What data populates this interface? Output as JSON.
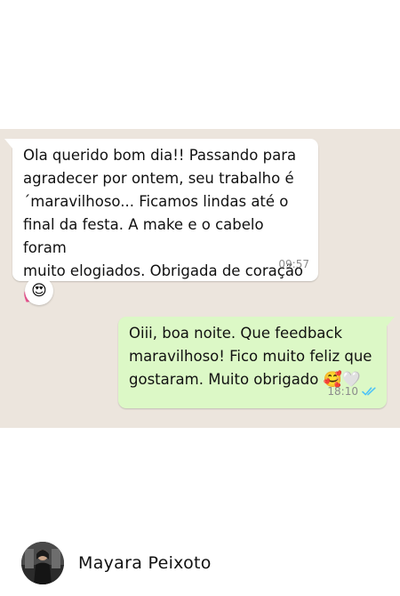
{
  "conversation": {
    "messages": [
      {
        "direction": "incoming",
        "text": "Ola querido bom dia!! Passando para\nagradecer por ontem, seu trabalho é\n´maravilhoso... Ficamos lindas até o\nfinal da festa. A make e o cabelo foram\nmuito elogiados. Obrigada de coração",
        "emoji": "💕",
        "time": "09:57",
        "reaction": "😍"
      },
      {
        "direction": "outgoing",
        "text": "Oiii, boa noite. Que feedback\nmaravilhoso! Fico muito feliz que\ngostaram. Muito obrigado ",
        "emoji": "🥰🤍",
        "time": "18:10",
        "status_icon": "double-check-read-icon",
        "status_color": "#4fc3f7"
      }
    ]
  },
  "author": {
    "name": "Mayara Peixoto"
  },
  "colors": {
    "chat_background": "#ece5dd",
    "incoming_bubble": "#ffffff",
    "outgoing_bubble": "#dcf8c6"
  }
}
